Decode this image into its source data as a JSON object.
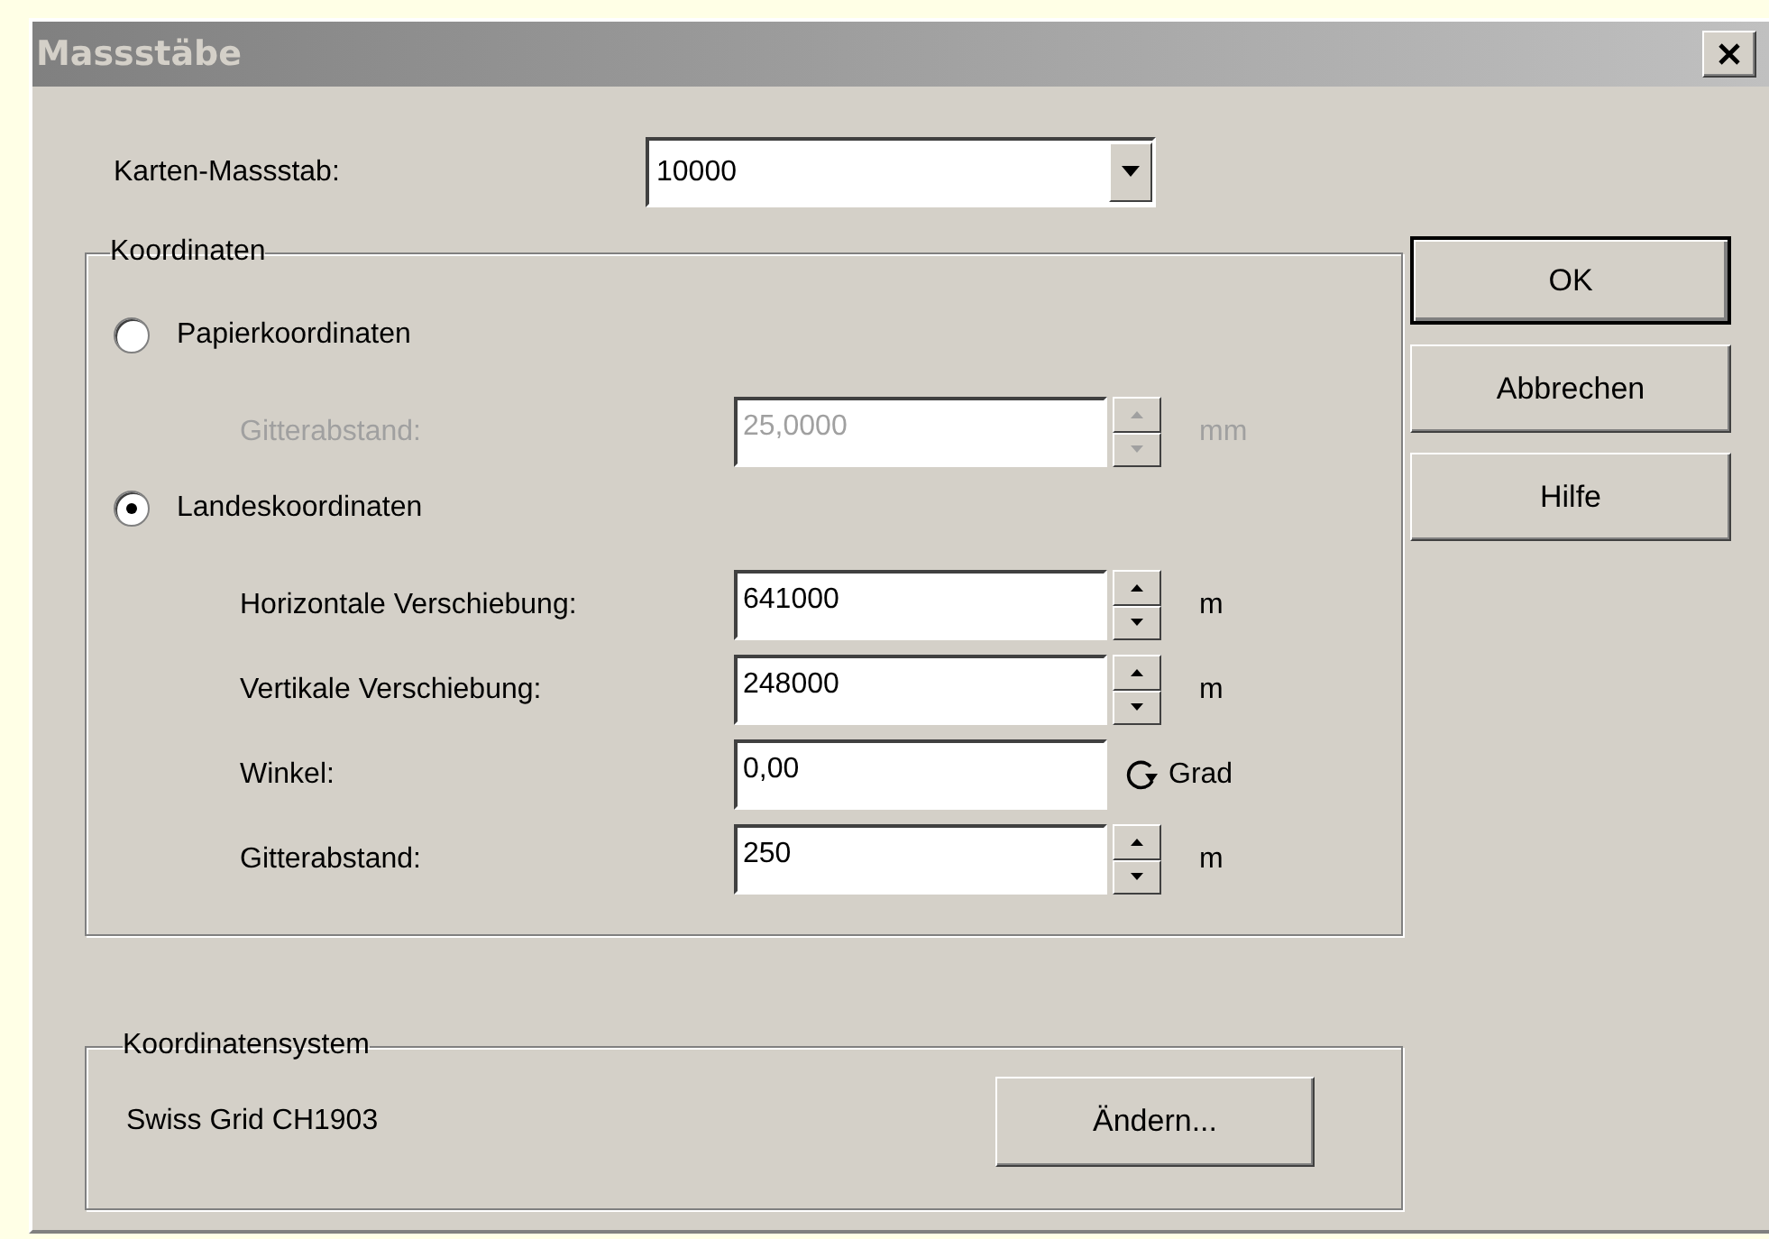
{
  "window": {
    "title": "Massstäbe"
  },
  "scale": {
    "label": "Karten-Massstab:",
    "value": "10000"
  },
  "coordinates": {
    "legend": "Koordinaten",
    "options": [
      {
        "label": "Papierkoordinaten",
        "selected": false,
        "fields": [
          {
            "kind": "spin",
            "label": "Gitterabstand:",
            "value": "25,0000",
            "unit": "mm",
            "disabled": true
          }
        ]
      },
      {
        "label": "Landeskoordinaten",
        "selected": true,
        "fields": [
          {
            "kind": "spin",
            "label": "Horizontale Verschiebung:",
            "value": "641000",
            "unit": "m",
            "disabled": false
          },
          {
            "kind": "spin",
            "label": "Vertikale Verschiebung:",
            "value": "248000",
            "unit": "m",
            "disabled": false
          },
          {
            "kind": "rotate",
            "label": "Winkel:",
            "value": "0,00",
            "unit": "Grad",
            "disabled": false
          },
          {
            "kind": "spin",
            "label": "Gitterabstand:",
            "value": "250",
            "unit": "m",
            "disabled": false
          }
        ]
      }
    ]
  },
  "system": {
    "legend": "Koordinatensystem",
    "name": "Swiss Grid CH1903",
    "button": "Ändern..."
  },
  "buttons": [
    {
      "label": "OK",
      "default": true
    },
    {
      "label": "Abbrechen",
      "default": false
    },
    {
      "label": "Hilfe",
      "default": false
    }
  ]
}
